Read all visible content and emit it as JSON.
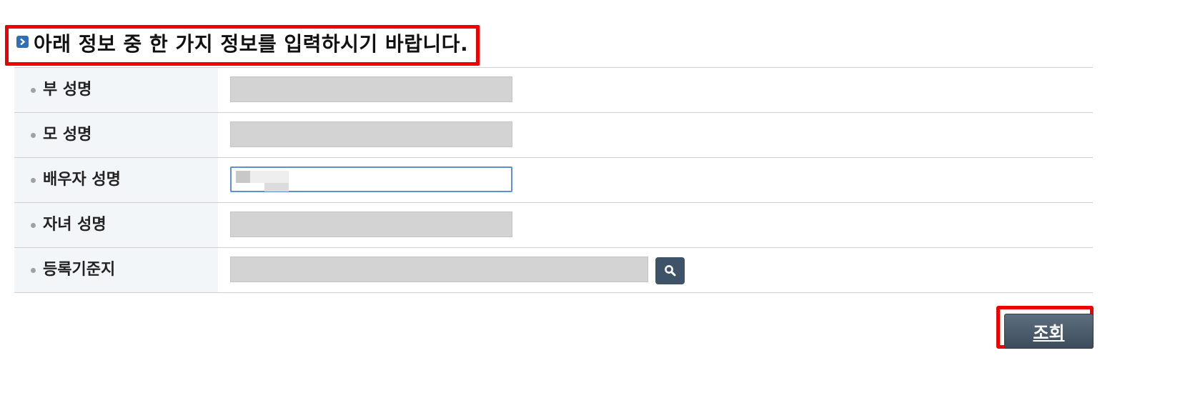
{
  "instruction": {
    "text": "아래 정보 중 한 가지 정보를 입력하시기 바랍니다."
  },
  "form": {
    "rows": [
      {
        "label": "부 성명",
        "value": ""
      },
      {
        "label": "모 성명",
        "value": ""
      },
      {
        "label": "배우자 성명",
        "value": ""
      },
      {
        "label": "자녀 성명",
        "value": ""
      },
      {
        "label": "등록기준지",
        "value": ""
      }
    ]
  },
  "actions": {
    "submit_label": "조회"
  },
  "icons": {
    "title": "arrow-right-icon",
    "bullet": "bullet-icon",
    "search": "search-icon"
  },
  "colors": {
    "highlight": "#ee0000",
    "title_icon": "#2f6fb7",
    "button": "#3e5368",
    "label_bg": "#f3f6f9",
    "disabled_field": "#d3d3d3",
    "active_border": "#5b8fd6"
  }
}
